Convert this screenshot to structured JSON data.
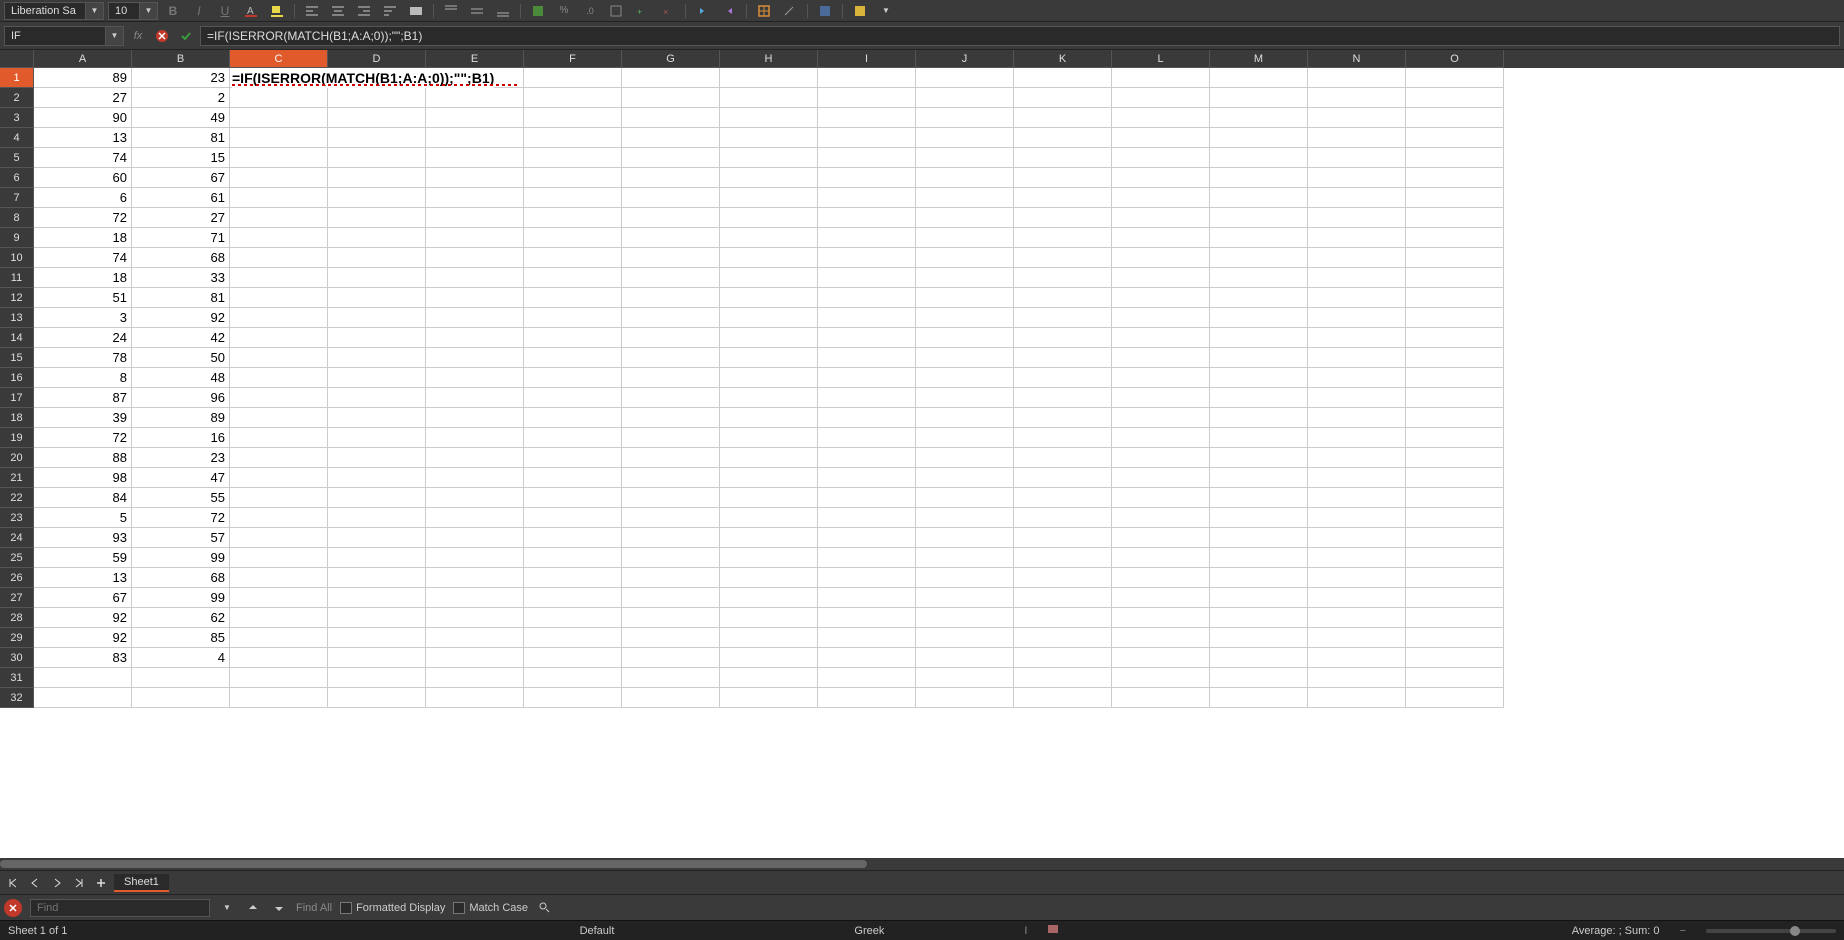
{
  "toolbar": {
    "font_name": "Liberation Sa",
    "font_size": "10"
  },
  "formula_bar": {
    "name_box": "IF",
    "formula": "=IF(ISERROR(MATCH(B1;A:A;0));\"\";B1)"
  },
  "columns": [
    "A",
    "B",
    "C",
    "D",
    "E",
    "F",
    "G",
    "H",
    "I",
    "J",
    "K",
    "L",
    "M",
    "N",
    "O"
  ],
  "active_col": "C",
  "active_row": 1,
  "editing_cell_text": "=IF(ISERROR(MATCH(B1;A:A;0));\"\";B1)",
  "rows": [
    {
      "n": 1,
      "A": "89",
      "B": "23"
    },
    {
      "n": 2,
      "A": "27",
      "B": "2"
    },
    {
      "n": 3,
      "A": "90",
      "B": "49"
    },
    {
      "n": 4,
      "A": "13",
      "B": "81"
    },
    {
      "n": 5,
      "A": "74",
      "B": "15"
    },
    {
      "n": 6,
      "A": "60",
      "B": "67"
    },
    {
      "n": 7,
      "A": "6",
      "B": "61"
    },
    {
      "n": 8,
      "A": "72",
      "B": "27"
    },
    {
      "n": 9,
      "A": "18",
      "B": "71"
    },
    {
      "n": 10,
      "A": "74",
      "B": "68"
    },
    {
      "n": 11,
      "A": "18",
      "B": "33"
    },
    {
      "n": 12,
      "A": "51",
      "B": "81"
    },
    {
      "n": 13,
      "A": "3",
      "B": "92"
    },
    {
      "n": 14,
      "A": "24",
      "B": "42"
    },
    {
      "n": 15,
      "A": "78",
      "B": "50"
    },
    {
      "n": 16,
      "A": "8",
      "B": "48"
    },
    {
      "n": 17,
      "A": "87",
      "B": "96"
    },
    {
      "n": 18,
      "A": "39",
      "B": "89"
    },
    {
      "n": 19,
      "A": "72",
      "B": "16"
    },
    {
      "n": 20,
      "A": "88",
      "B": "23"
    },
    {
      "n": 21,
      "A": "98",
      "B": "47"
    },
    {
      "n": 22,
      "A": "84",
      "B": "55"
    },
    {
      "n": 23,
      "A": "5",
      "B": "72"
    },
    {
      "n": 24,
      "A": "93",
      "B": "57"
    },
    {
      "n": 25,
      "A": "59",
      "B": "99"
    },
    {
      "n": 26,
      "A": "13",
      "B": "68"
    },
    {
      "n": 27,
      "A": "67",
      "B": "99"
    },
    {
      "n": 28,
      "A": "92",
      "B": "62"
    },
    {
      "n": 29,
      "A": "92",
      "B": "85"
    },
    {
      "n": 30,
      "A": "83",
      "B": "4"
    },
    {
      "n": 31,
      "A": "",
      "B": ""
    },
    {
      "n": 32,
      "A": "",
      "B": ""
    }
  ],
  "sheet_tabs": {
    "active": "Sheet1"
  },
  "findbar": {
    "placeholder": "Find",
    "find_all": "Find All",
    "formatted": "Formatted Display",
    "match_case": "Match Case"
  },
  "statusbar": {
    "sheet_info": "Sheet 1 of 1",
    "style": "Default",
    "lang": "Greek",
    "summary": "Average: ; Sum: 0"
  }
}
